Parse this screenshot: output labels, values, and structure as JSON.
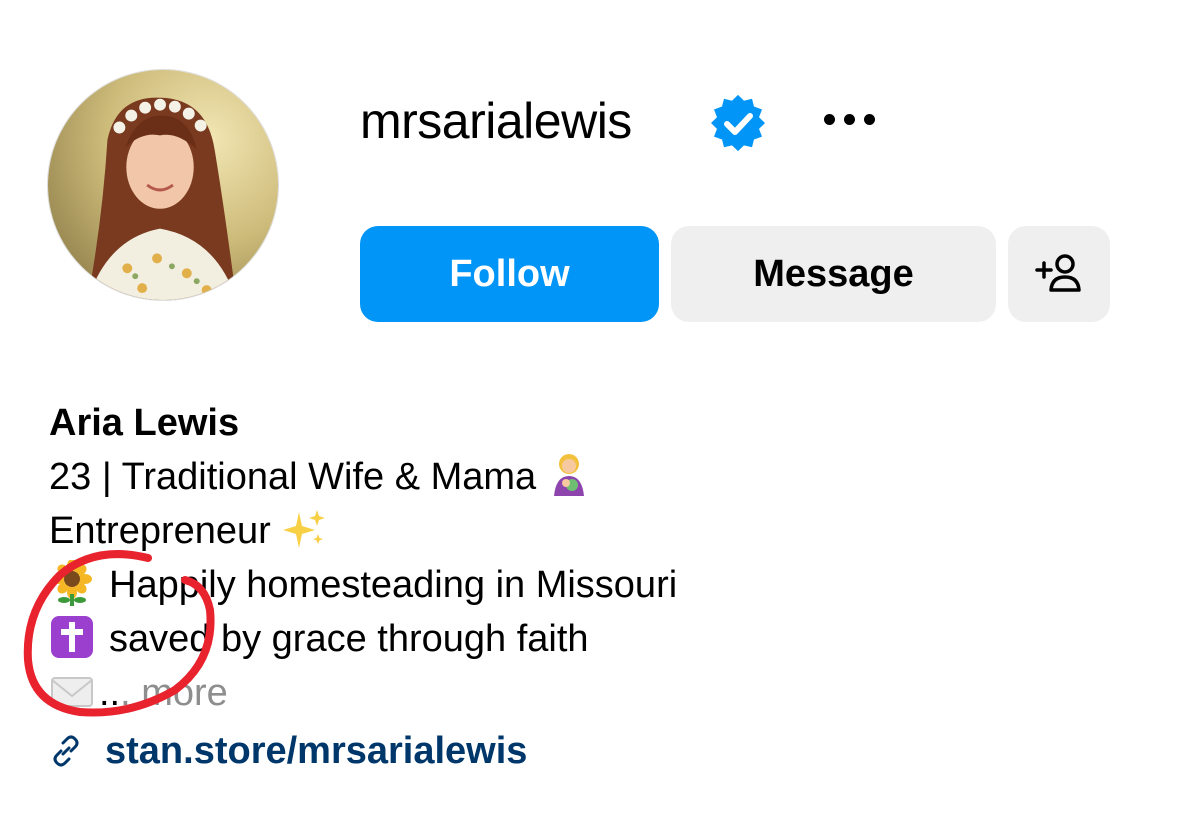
{
  "profile": {
    "username": "mrsarialewis",
    "verified_icon": "verified-badge-icon",
    "more_icon": "more-horizontal-icon",
    "avatar_icon": "profile-photo"
  },
  "actions": {
    "follow_label": "Follow",
    "message_label": "Message",
    "add_user_icon": "add-user-icon"
  },
  "bio": {
    "full_name": "Aria Lewis",
    "line1": "23 | Traditional Wife & Mama",
    "line2": "Entrepreneur",
    "line3": "Happily homesteading in Missouri",
    "line4": "saved by grace through faith",
    "line5_prefix": "..",
    "more_label": ". more",
    "link": "stan.store/mrsarialewis",
    "link_icon": "link-icon"
  },
  "colors": {
    "follow_blue": "#0095f6",
    "secondary_button": "#efefef",
    "link_blue": "#00376b",
    "muted": "#8e8e8e",
    "verified_blue": "#0095f6",
    "annotation_red": "#e8232e"
  }
}
